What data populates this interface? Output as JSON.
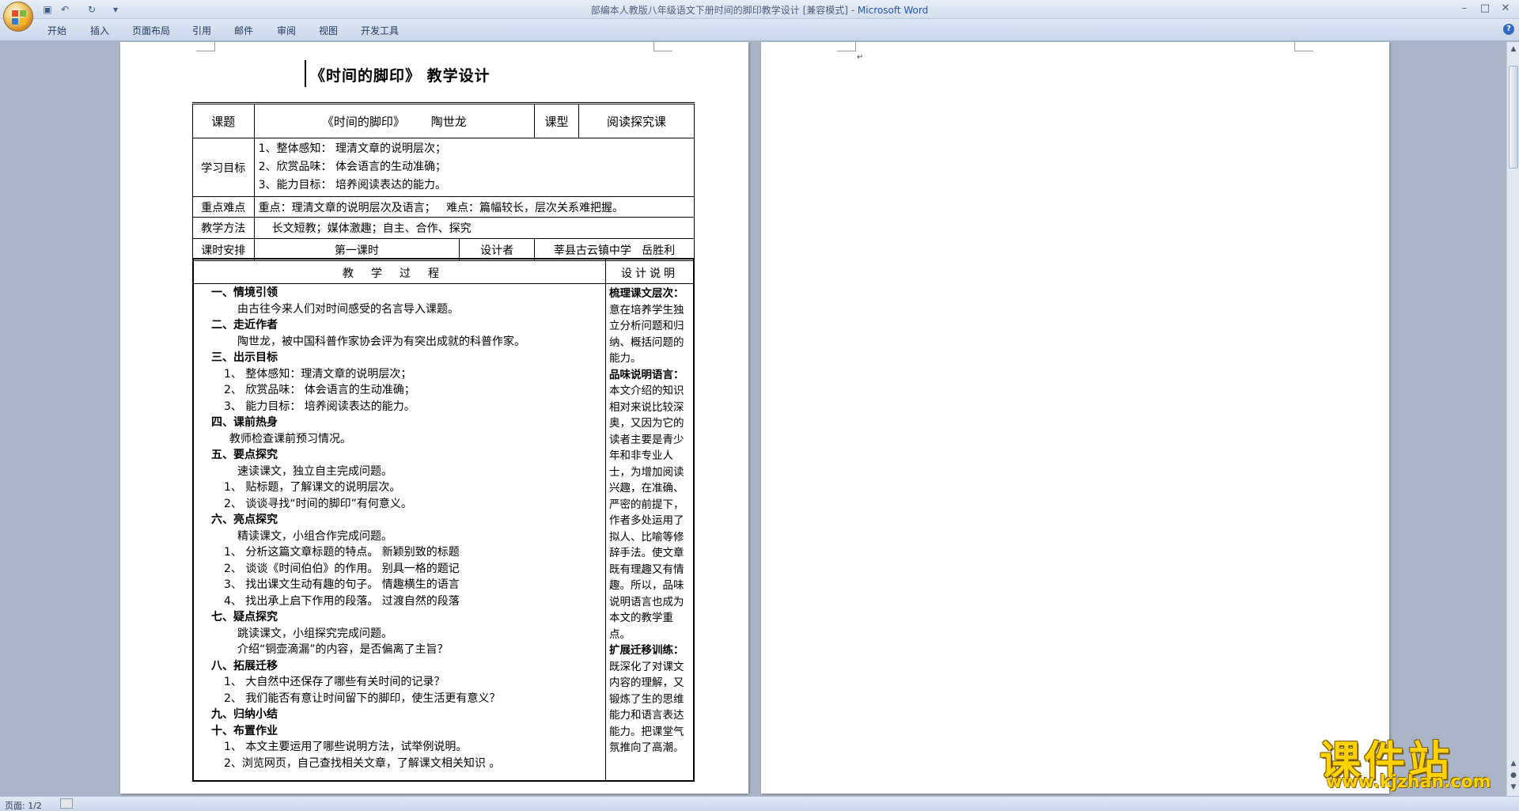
{
  "window": {
    "title_doc": "部编本人教版八年级语文下册时间的脚印教学设计 [兼容模式] - ",
    "title_app": "Microsoft Word"
  },
  "quick_access": {
    "save_icon": "save-icon",
    "undo_icon": "undo-icon",
    "redo_icon": "redo-icon",
    "customize_icon": "dropdown-icon"
  },
  "ribbon": {
    "tabs": [
      "开始",
      "插入",
      "页面布局",
      "引用",
      "邮件",
      "审阅",
      "视图",
      "开发工具"
    ]
  },
  "document": {
    "title": "《时间的脚印》 教学设计",
    "info": {
      "topic_label": "课题",
      "topic_value": "《时间的脚印》",
      "author": "陶世龙",
      "type_label": "课型",
      "type_value": "阅读探究课",
      "goals_label": "学习目标",
      "goals": [
        "1、整体感知： 理清文章的说明层次；",
        "2、欣赏品味： 体会语言的生动准确；",
        "3、能力目标： 培养阅读表达的能力。"
      ],
      "focus_label": "重点难点",
      "focus_value": "重点：理清文章的说明层次及语言；   难点：篇幅较长，层次关系难把握。",
      "method_label": "教学方法",
      "method_value": "长文短教；媒体激趣；自主、合作、探究",
      "schedule_label": "课时安排",
      "schedule_value": "第一课时",
      "designer_label": "设计者",
      "designer_value": "莘县古云镇中学   岳胜利"
    },
    "process_header": "教学过程",
    "design_header": "设计说明",
    "process_lines": [
      {
        "t": "一、情境引领",
        "k": "h"
      },
      {
        "t": "由古往今来人们对时间感受的名言导入课题。",
        "k": "i1"
      },
      {
        "t": "二、走近作者",
        "k": "h"
      },
      {
        "t": "陶世龙，被中国科普作家协会评为有突出成就的科普作家。",
        "k": "i1"
      },
      {
        "t": "三、出示目标",
        "k": "h"
      },
      {
        "t": "1、 整体感知：理清文章的说明层次；",
        "k": "i2"
      },
      {
        "t": "2、 欣赏品味：  体会语言的生动准确；",
        "k": "i2"
      },
      {
        "t": "3、 能力目标：  培养阅读表达的能力。",
        "k": "i2"
      },
      {
        "t": "四、课前热身",
        "k": "h"
      },
      {
        "t": "教师检查课前预习情况。",
        "k": "i3"
      },
      {
        "t": "五、要点探究",
        "k": "h"
      },
      {
        "t": "速读课文，独立自主完成问题。",
        "k": "i1"
      },
      {
        "t": "1、 贴标题，了解课文的说明层次。",
        "k": "i2"
      },
      {
        "t": "2、 谈谈寻找“时间的脚印”有何意义。",
        "k": "i2"
      },
      {
        "t": "六、亮点探究",
        "k": "h"
      },
      {
        "t": "精读课文，小组合作完成问题。",
        "k": "i1"
      },
      {
        "t": "1、 分析这篇文章标题的特点。   新颖别致的标题",
        "k": "i2"
      },
      {
        "t": "2、 谈谈《时间伯伯》的作用。   别具一格的题记",
        "k": "i2"
      },
      {
        "t": "3、 找出课文生动有趣的句子。   情趣横生的语言",
        "k": "i2"
      },
      {
        "t": "4、 找出承上启下作用的段落。   过渡自然的段落",
        "k": "i2"
      },
      {
        "t": "七、疑点探究",
        "k": "h"
      },
      {
        "t": "跳读课文，小组探究完成问题。",
        "k": "i1"
      },
      {
        "t": "介绍“铜壶滴漏”的内容，是否偏离了主旨？",
        "k": "i1"
      },
      {
        "t": "八、拓展迁移",
        "k": "h"
      },
      {
        "t": "1、 大自然中还保存了哪些有关时间的记录？",
        "k": "i2"
      },
      {
        "t": "2、 我们能否有意让时间留下的脚印，使生活更有意义？",
        "k": "i2"
      },
      {
        "t": "九、归纳小结",
        "k": "h"
      },
      {
        "t": "十、布置作业",
        "k": "h"
      },
      {
        "t": "1、 本文主要运用了哪些说明方法，试举例说明。",
        "k": "i2"
      },
      {
        "t": "2、浏览网页，自己查找相关文章，了解课文相关知识 。",
        "k": "i2"
      }
    ],
    "design_lines": [
      {
        "t": "梳理课文层次：",
        "k": "dh"
      },
      {
        "t": "意在培养学生独",
        "k": "d"
      },
      {
        "t": "立分析问题和归",
        "k": "d"
      },
      {
        "t": "纳、概括问题的",
        "k": "d"
      },
      {
        "t": "能力。",
        "k": "d"
      },
      {
        "t": "品味说明语言：",
        "k": "dh"
      },
      {
        "t": "本文介绍的知识",
        "k": "d"
      },
      {
        "t": "相对来说比较深",
        "k": "d"
      },
      {
        "t": "奥，又因为它的",
        "k": "d"
      },
      {
        "t": "读者主要是青少",
        "k": "d"
      },
      {
        "t": "年和非专业人",
        "k": "d"
      },
      {
        "t": "士，为增加阅读",
        "k": "d"
      },
      {
        "t": "兴趣，在准确、",
        "k": "d"
      },
      {
        "t": "严密的前提下，",
        "k": "d"
      },
      {
        "t": "作者多处运用了",
        "k": "d"
      },
      {
        "t": "拟人、比喻等修",
        "k": "d"
      },
      {
        "t": "辞手法。使文章",
        "k": "d"
      },
      {
        "t": "既有理趣又有情",
        "k": "d"
      },
      {
        "t": "趣。所以，品味",
        "k": "d"
      },
      {
        "t": "说明语言也成为",
        "k": "d"
      },
      {
        "t": "本文的教学重",
        "k": "d"
      },
      {
        "t": "点。",
        "k": "d"
      },
      {
        "t": "扩展迁移训练：",
        "k": "dh"
      },
      {
        "t": "既深化了对课文",
        "k": "d"
      },
      {
        "t": "内容的理解，又",
        "k": "d"
      },
      {
        "t": "锻炼了生的思维",
        "k": "d"
      },
      {
        "t": "能力和语言表达",
        "k": "d"
      },
      {
        "t": "能力。把课堂气",
        "k": "d"
      },
      {
        "t": "氛推向了高潮。",
        "k": "d"
      }
    ]
  },
  "status": {
    "page": "页面: 1/2"
  },
  "watermark": {
    "cn": "课件站",
    "url": "www.kjzhan.com"
  }
}
